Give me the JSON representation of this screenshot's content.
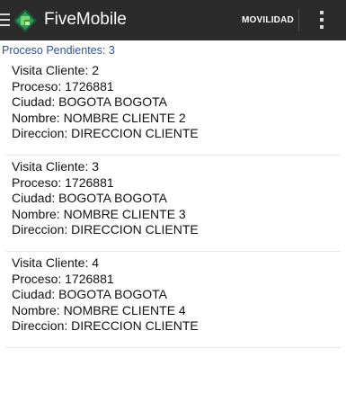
{
  "app_bar": {
    "title": "FiveMobile",
    "action_label": "MOVILIDAD",
    "menu_icon": "hamburger-menu-icon",
    "logo_icon": "fivemobile-logo-icon",
    "overflow_icon": "more-vert-icon",
    "colors": {
      "background": "#2b2b2b",
      "logo_dark": "#1e5b3d",
      "logo_mid": "#2b9b59",
      "logo_light": "#7ed36f"
    }
  },
  "pending": {
    "label": "Proceso Pendientes: 3",
    "color": "#2f5597"
  },
  "visits": [
    {
      "visit": "Visita Cliente: 2",
      "process": "Proceso: 1726881",
      "city": "Ciudad: BOGOTA BOGOTA",
      "name": "Nombre: NOMBRE CLIENTE 2",
      "address": "Direccion: DIRECCION CLIENTE"
    },
    {
      "visit": "Visita Cliente: 3",
      "process": "Proceso: 1726881",
      "city": "Ciudad: BOGOTA BOGOTA",
      "name": "Nombre: NOMBRE CLIENTE 3",
      "address": "Direccion: DIRECCION CLIENTE"
    },
    {
      "visit": "Visita Cliente: 4",
      "process": "Proceso: 1726881",
      "city": "Ciudad: BOGOTA BOGOTA",
      "name": "Nombre: NOMBRE CLIENTE 4",
      "address": "Direccion: DIRECCION CLIENTE"
    }
  ]
}
